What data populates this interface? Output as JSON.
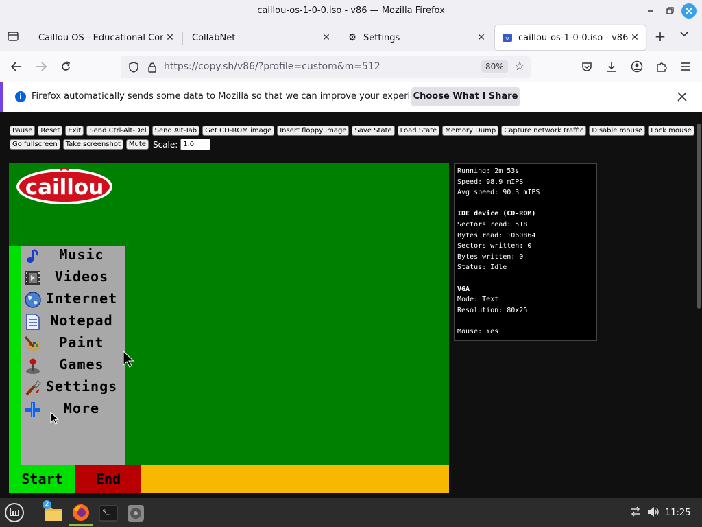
{
  "window": {
    "title": "caillou-os-1-0-0.iso - v86 — Mozilla Firefox"
  },
  "tabs": [
    {
      "label": "Caillou OS - Educational Compu",
      "active": false
    },
    {
      "label": "CollabNet",
      "active": false
    },
    {
      "label": "Settings",
      "active": false,
      "icon": "gear-icon"
    },
    {
      "label": "caillou-os-1-0-0.iso - v86",
      "active": true,
      "icon": "v86-favicon"
    }
  ],
  "navbar": {
    "url": "https://copy.sh/v86/?profile=custom&m=512",
    "zoom": "80%"
  },
  "notification": {
    "message": "Firefox automatically sends some data to Mozilla so that we can improve your experience.",
    "button": "Choose What I Share"
  },
  "emulator": {
    "buttons_row1": [
      "Pause",
      "Reset",
      "Exit",
      "Send Ctrl-Alt-Del",
      "Send Alt-Tab",
      "Get CD-ROM image",
      "Insert floppy image",
      "Save State",
      "Load State",
      "Memory Dump",
      "Capture network traffic",
      "Disable mouse",
      "Lock mouse"
    ],
    "buttons_row2": [
      "Go fullscreen",
      "Take screenshot",
      "Mute"
    ],
    "scale_label": "Scale:",
    "scale_value": "1.0"
  },
  "guest": {
    "logo_text": "caillou",
    "menu": [
      {
        "label": "Music",
        "icon": "music-note-icon"
      },
      {
        "label": "Videos",
        "icon": "film-icon"
      },
      {
        "label": "Internet",
        "icon": "globe-icon"
      },
      {
        "label": "Notepad",
        "icon": "notepad-icon"
      },
      {
        "label": "Paint",
        "icon": "paint-palette-icon"
      },
      {
        "label": "Games",
        "icon": "joystick-icon"
      },
      {
        "label": "Settings",
        "icon": "wrench-icon"
      },
      {
        "label": "More",
        "icon": "plus-icon"
      }
    ],
    "start_label": "Start",
    "end_label": "End",
    "colors": {
      "desktop": "#008000",
      "start": "#00e000",
      "end": "#b80000",
      "taskbar": "#f8b800",
      "panel": "#a8a8a8"
    }
  },
  "stats": {
    "running": "Running: 2m 53s",
    "speed": "Speed: 98.9 mIPS",
    "avg_speed": "Avg speed: 90.3 mIPS",
    "ide_title": "IDE device (CD-ROM)",
    "sectors_read": "Sectors read: 518",
    "bytes_read": "Bytes read: 1060864",
    "sectors_written": "Sectors written: 0",
    "bytes_written": "Bytes written: 0",
    "status": "Status: Idle",
    "vga_title": "VGA",
    "mode": "Mode: Text",
    "resolution": "Resolution: 80x25",
    "mouse": "Mouse: Yes"
  },
  "taskbar": {
    "files_badge": "2",
    "clock": "11:25"
  }
}
